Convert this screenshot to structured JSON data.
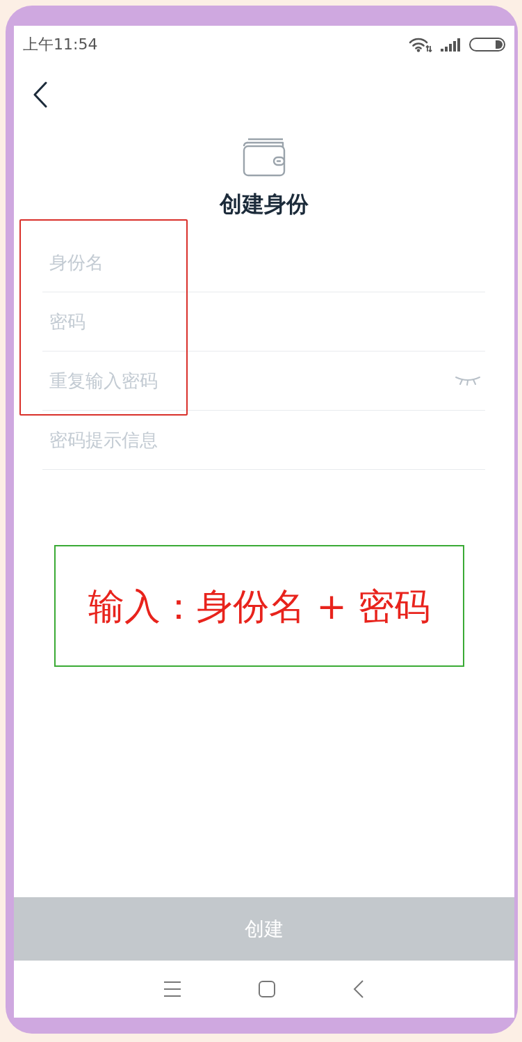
{
  "status_bar": {
    "time": "上午11:54"
  },
  "header": {
    "title": "创建身份"
  },
  "form": {
    "fields": [
      {
        "placeholder": "身份名",
        "kind": "plain"
      },
      {
        "placeholder": "密码",
        "kind": "plain"
      },
      {
        "placeholder": "重复输入密码",
        "kind": "toggle"
      },
      {
        "placeholder": "密码提示信息",
        "kind": "plain"
      }
    ]
  },
  "annotations": [
    {
      "kind": "frame",
      "color": "#d9302a"
    },
    {
      "kind": "callout",
      "color": "#3aaa35",
      "text": "输入：身份名 + 密码"
    }
  ],
  "submit_button": {
    "label": "创建",
    "disabled": true
  }
}
